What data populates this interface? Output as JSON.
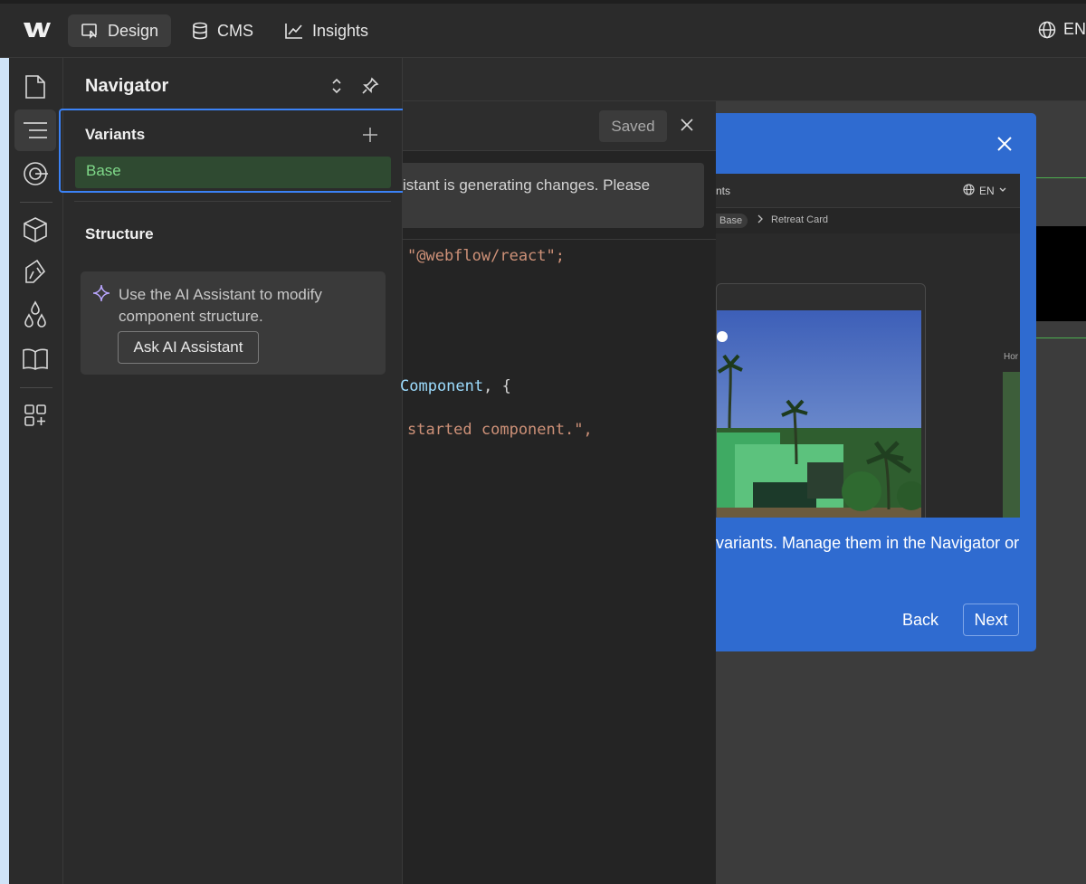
{
  "topbar": {
    "tabs": [
      {
        "label": "Design",
        "icon": "design-cursor-icon",
        "active": true
      },
      {
        "label": "CMS",
        "icon": "database-icon",
        "active": false
      },
      {
        "label": "Insights",
        "icon": "chart-line-icon",
        "active": false
      }
    ],
    "language": "EN"
  },
  "rail": {
    "items": [
      "pages-icon",
      "navigator-icon",
      "components-icon",
      "assets-box-icon",
      "styles-icon",
      "variables-icon",
      "library-icon",
      "apps-icon"
    ],
    "active": "navigator-icon"
  },
  "navigator": {
    "title": "Navigator",
    "variants_title": "Variants",
    "variant_items": [
      "Base"
    ],
    "structure_title": "Structure",
    "ai_card": {
      "message": "Use the AI Assistant to modify component structure.",
      "button": "Ask AI Assistant"
    }
  },
  "code_panel": {
    "status": "Saved",
    "generating_message": "istant is generating changes. Please",
    "line1": "\"@webflow/react\";",
    "line2_type": "Component",
    "line2_rest": ", {",
    "line3": "started component.\","
  },
  "dialog": {
    "preview": {
      "top_text": "nts",
      "language": "EN",
      "crumb_badge": "Base",
      "crumb_current": "Retreat Card",
      "side_label": "Hor"
    },
    "body_text": "variants. Manage them in the Navigator or",
    "back_label": "Back",
    "next_label": "Next"
  },
  "colors": {
    "accent_blue": "#2f6bd0",
    "selection_green": "#2f4a31",
    "selection_text": "#7fd989",
    "string_color": "#ce9178"
  }
}
